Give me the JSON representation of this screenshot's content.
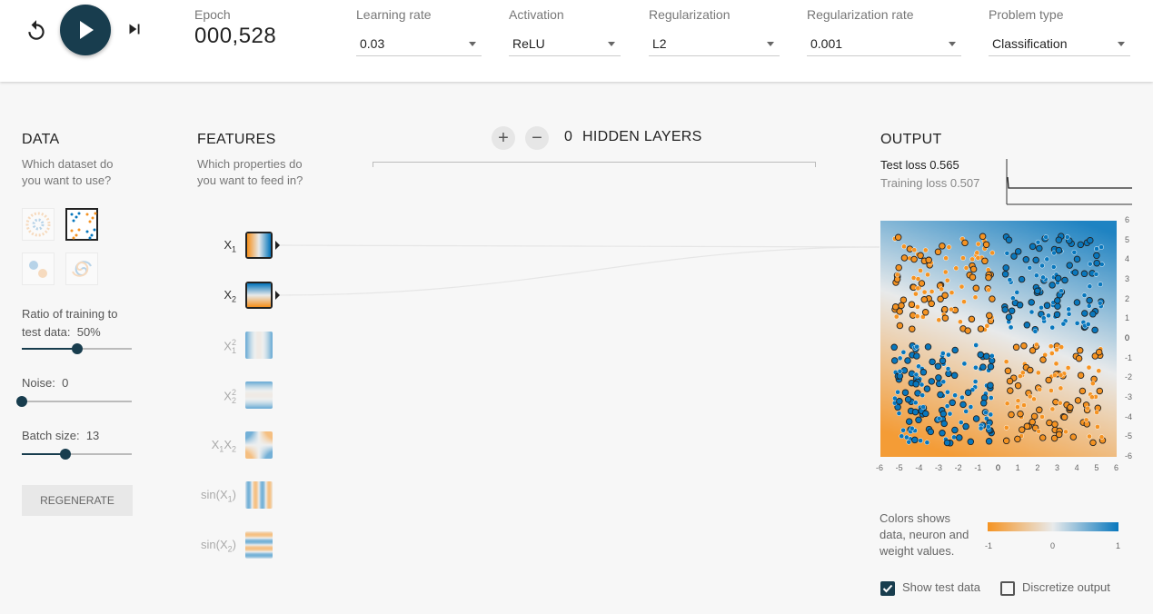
{
  "controls": {
    "reset_icon": "reset-icon",
    "play_icon": "play-icon",
    "step_icon": "step-forward-icon",
    "epoch_label": "Epoch",
    "epoch_value": "000,528",
    "learning_rate": {
      "label": "Learning rate",
      "value": "0.03"
    },
    "activation": {
      "label": "Activation",
      "value": "ReLU"
    },
    "regularization": {
      "label": "Regularization",
      "value": "L2"
    },
    "regularization_rate": {
      "label": "Regularization rate",
      "value": "0.001"
    },
    "problem_type": {
      "label": "Problem type",
      "value": "Classification"
    }
  },
  "data_panel": {
    "title": "DATA",
    "subtitle_line1": "Which dataset do",
    "subtitle_line2": "you want to use?",
    "datasets": [
      "circle",
      "xor",
      "gaussian",
      "spiral"
    ],
    "selected_dataset": "xor",
    "ratio": {
      "label": "Ratio of training to",
      "label2": "test data:",
      "value": "50%",
      "fraction": 0.5
    },
    "noise": {
      "label": "Noise:",
      "value": "0",
      "fraction": 0
    },
    "batch": {
      "label": "Batch size:",
      "value": "13",
      "fraction": 0.4
    },
    "regenerate": "REGENERATE"
  },
  "features_panel": {
    "title": "FEATURES",
    "subtitle_line1": "Which properties do",
    "subtitle_line2": "you want to feed in?",
    "features": [
      {
        "base": "X",
        "sub": "1",
        "sup": "",
        "tail": "",
        "active": true
      },
      {
        "base": "X",
        "sub": "2",
        "sup": "",
        "tail": "",
        "active": true
      },
      {
        "base": "X",
        "sub": "1",
        "sup": "2",
        "tail": "",
        "active": false
      },
      {
        "base": "X",
        "sub": "2",
        "sup": "2",
        "tail": "",
        "active": false
      },
      {
        "base": "X",
        "sub": "1",
        "sup": "",
        "tail": "X",
        "sub2": "2",
        "active": false
      },
      {
        "base": "sin(X",
        "sub": "1",
        "sup": "",
        "tail": ")",
        "active": false
      },
      {
        "base": "sin(X",
        "sub": "2",
        "sup": "",
        "tail": ")",
        "active": false
      }
    ]
  },
  "network": {
    "hidden_layers_count": "0",
    "hidden_layers_label": "HIDDEN LAYERS",
    "add_layer": "+",
    "remove_layer": "−"
  },
  "output_panel": {
    "title": "OUTPUT",
    "test_loss_label": "Test loss",
    "test_loss_value": "0.565",
    "training_loss_label": "Training loss",
    "training_loss_value": "0.507",
    "y_ticks": [
      "6",
      "5",
      "4",
      "3",
      "2",
      "1",
      "0",
      "-1",
      "-2",
      "-3",
      "-4",
      "-5",
      "-6"
    ],
    "x_ticks": [
      "-6",
      "-5",
      "-4",
      "-3",
      "-2",
      "-1",
      "0",
      "1",
      "2",
      "3",
      "4",
      "5",
      "6"
    ],
    "legend_text_1": "Colors shows",
    "legend_text_2": "data, neuron and",
    "legend_text_3": "weight values.",
    "legend_ticks": [
      "-1",
      "0",
      "1"
    ],
    "show_test_data": {
      "label": "Show test data",
      "checked": true
    },
    "discretize": {
      "label": "Discretize output",
      "checked": false
    },
    "colors": {
      "orange": "#f59322",
      "blue": "#0877bd",
      "dark": "#183d4e"
    }
  }
}
